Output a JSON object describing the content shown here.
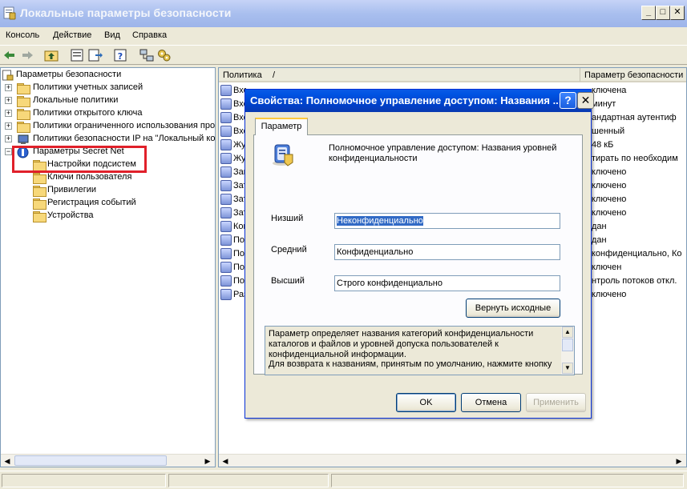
{
  "window": {
    "title": "Локальные параметры безопасности",
    "min": "_",
    "max": "□",
    "close": "✕"
  },
  "menu": [
    "Консоль",
    "Действие",
    "Вид",
    "Справка"
  ],
  "tree": {
    "root": "Параметры безопасности",
    "items": [
      "Политики учетных записей",
      "Локальные политики",
      "Политики открытого ключа",
      "Политики ограниченного использования программ",
      "Политики безопасности IP на \"Локальный компьютер\"",
      "Параметры Secret Net"
    ],
    "children": [
      "Настройки подсистем",
      "Ключи пользователя",
      "Привилегии",
      "Регистрация событий",
      "Устройства"
    ]
  },
  "list": {
    "col_policy": "Политика",
    "sort_mark": "/",
    "col_param": "Параметр безопасности",
    "rows": [
      {
        "name": "Вход",
        "val": "ключена"
      },
      {
        "name": "Вход",
        "val": "минут"
      },
      {
        "name": "Вход",
        "val": "андартная аутентиф"
      },
      {
        "name": "Вход",
        "val": "шенный"
      },
      {
        "name": "Жур",
        "val": "48 кБ"
      },
      {
        "name": "Жур",
        "val": "тирать по необходим"
      },
      {
        "name": "Зап",
        "val": "ключено"
      },
      {
        "name": "Зат",
        "val": "ключено"
      },
      {
        "name": "Зат",
        "val": "ключено"
      },
      {
        "name": "Зат",
        "val": "ключено"
      },
      {
        "name": "Конт",
        "val": "дан"
      },
      {
        "name": "Пол",
        "val": "дан"
      },
      {
        "name": "Пол",
        "val": "конфиденциально, Ко"
      },
      {
        "name": "Пол",
        "val": "ключен"
      },
      {
        "name": "Пол",
        "val": "нтроль потоков откл."
      },
      {
        "name": "Раз",
        "val": "ключено"
      }
    ]
  },
  "dialog": {
    "title": "Свойства: Полномочное управление доступом: Названия ...",
    "help": "?",
    "close": "✕",
    "tab": "Параметр",
    "heading": "Полномочное управление доступом: Названия уровней конфиденциальности",
    "low_label": "Низший",
    "low_value": "Неконфиденциально",
    "mid_label": "Средний",
    "mid_value": "Конфиденциально",
    "high_label": "Высший",
    "high_value": "Строго конфиденциально",
    "reset": "Вернуть исходные",
    "description": "Параметр определяет названия категорий конфиденциальности\nкаталогов и файлов и уровней допуска пользователей к\nконфиденциальной информации.\nДля возврата к названиям, принятым по умолчанию, нажмите кнопку",
    "ok": "OK",
    "cancel": "Отмена",
    "apply": "Применить"
  }
}
